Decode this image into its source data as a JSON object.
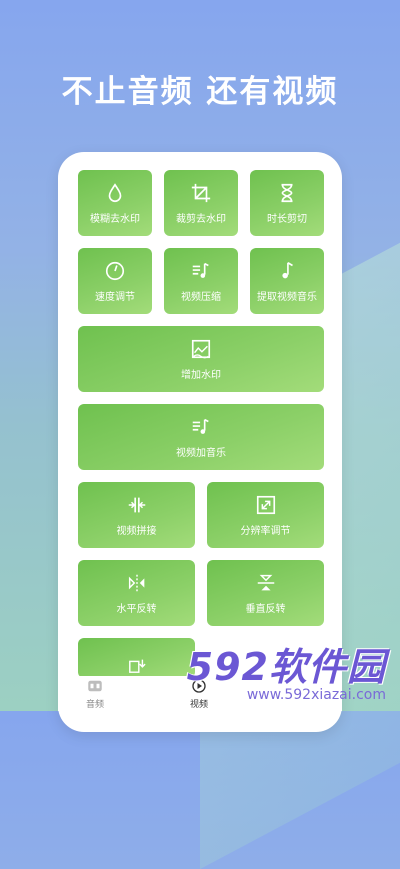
{
  "headline": "不止音频 还有视频",
  "tiles": [
    {
      "label": "模糊去水印",
      "icon": "water-drop-icon"
    },
    {
      "label": "裁剪去水印",
      "icon": "crop-icon"
    },
    {
      "label": "时长剪切",
      "icon": "hourglass-icon"
    },
    {
      "label": "速度调节",
      "icon": "speedometer-icon"
    },
    {
      "label": "视频压缩",
      "icon": "music-list-icon"
    },
    {
      "label": "提取视频音乐",
      "icon": "music-note-icon"
    },
    {
      "label": "增加水印",
      "icon": "image-wave-icon"
    },
    {
      "label": "视频加音乐",
      "icon": "music-list-icon"
    },
    {
      "label": "视频拼接",
      "icon": "merge-icon"
    },
    {
      "label": "分辨率调节",
      "icon": "resize-icon"
    },
    {
      "label": "水平反转",
      "icon": "flip-horizontal-icon"
    },
    {
      "label": "垂直反转",
      "icon": "flip-vertical-icon"
    }
  ],
  "tabs": [
    {
      "label": "音频",
      "icon": "audio-tab-icon"
    },
    {
      "label": "视频",
      "icon": "video-tab-icon"
    }
  ],
  "watermark": {
    "brand": "592软件园",
    "url": "www.592xiazai.com"
  },
  "colors": {
    "tile_green": "#7bc95a",
    "headline": "#ffffff",
    "watermark": "#6b57d4"
  }
}
